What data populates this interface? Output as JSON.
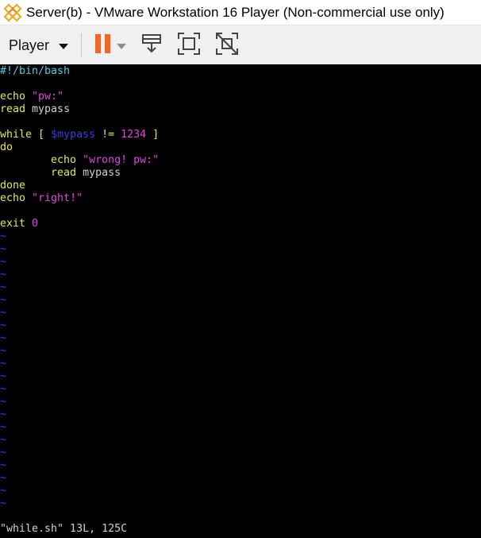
{
  "window": {
    "title": "Server(b) - VMware Workstation 16 Player (Non-commercial use only)",
    "icon": "vmware-logo-icon"
  },
  "toolbar": {
    "player_label": "Player",
    "buttons": [
      "pause-icon",
      "send-ctrl-alt-del-icon",
      "fullscreen-icon",
      "unity-icon"
    ]
  },
  "colors": {
    "pause_orange": "#f26522",
    "shebang": "#42d1e6",
    "keyword": "#e8e845",
    "string": "#e243e2",
    "variable": "#2f3fe6",
    "tilde": "#3a3aff"
  },
  "editor": {
    "lines": [
      {
        "segments": [
          {
            "t": "#!/bin/bash",
            "cls": "c"
          }
        ]
      },
      {
        "segments": []
      },
      {
        "segments": [
          {
            "t": "echo ",
            "cls": "y"
          },
          {
            "t": "\"pw:\"",
            "cls": "m"
          }
        ]
      },
      {
        "segments": [
          {
            "t": "read",
            "cls": "y"
          },
          {
            "t": " mypass",
            "cls": "w"
          }
        ]
      },
      {
        "segments": []
      },
      {
        "segments": [
          {
            "t": "while",
            "cls": "y"
          },
          {
            "t": " [ ",
            "cls": "y"
          },
          {
            "t": "$mypass",
            "cls": "b"
          },
          {
            "t": " != ",
            "cls": "y"
          },
          {
            "t": "1234",
            "cls": "m"
          },
          {
            "t": " ]",
            "cls": "y"
          }
        ]
      },
      {
        "segments": [
          {
            "t": "do",
            "cls": "y"
          }
        ]
      },
      {
        "segments": [
          {
            "t": "        echo ",
            "cls": "y"
          },
          {
            "t": "\"wrong! pw:\"",
            "cls": "m"
          }
        ]
      },
      {
        "segments": [
          {
            "t": "        read",
            "cls": "y"
          },
          {
            "t": " mypass",
            "cls": "w"
          }
        ]
      },
      {
        "segments": [
          {
            "t": "done",
            "cls": "y"
          }
        ]
      },
      {
        "segments": [
          {
            "t": "echo ",
            "cls": "y"
          },
          {
            "t": "\"right!\"",
            "cls": "m"
          }
        ]
      },
      {
        "segments": []
      },
      {
        "segments": [
          {
            "t": "exit",
            "cls": "y"
          },
          {
            "t": " 0",
            "cls": "m"
          }
        ]
      }
    ],
    "tilde_char": "~",
    "tilde_count": 22,
    "status_line": "\"while.sh\" 13L, 125C"
  }
}
